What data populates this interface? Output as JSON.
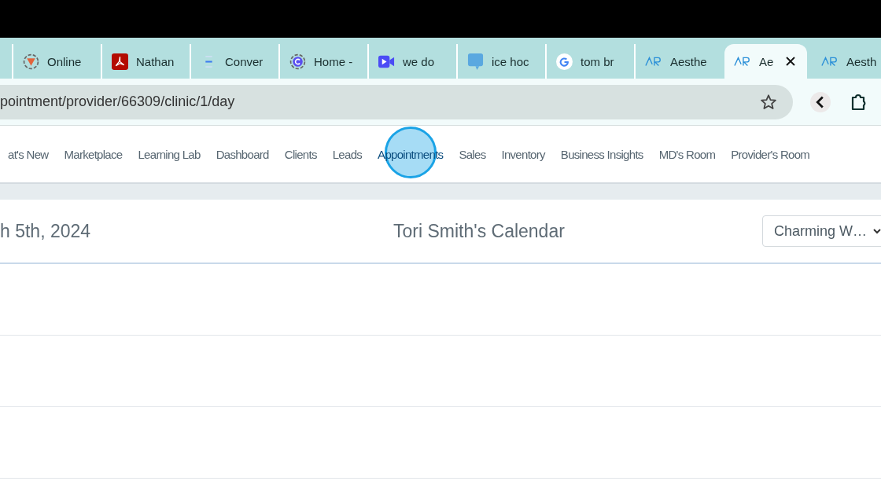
{
  "browser_tabs": [
    {
      "title": "Online",
      "kind": "shield",
      "selected": false
    },
    {
      "title": "Nathan",
      "kind": "pdf",
      "selected": false
    },
    {
      "title": "Conver",
      "kind": "bars",
      "selected": false
    },
    {
      "title": "Home -",
      "kind": "circle",
      "selected": false
    },
    {
      "title": "we do",
      "kind": "video",
      "selected": false
    },
    {
      "title": "ice hoc",
      "kind": "chat",
      "selected": false
    },
    {
      "title": "tom br",
      "kind": "google",
      "selected": false
    },
    {
      "title": "Aesthe",
      "kind": "ar",
      "selected": false
    },
    {
      "title": "Ae",
      "kind": "ar",
      "selected": true
    },
    {
      "title": "Aesth",
      "kind": "ar",
      "selected": false
    }
  ],
  "address_bar": {
    "url": "pointment/provider/66309/clinic/1/day"
  },
  "nav": [
    {
      "label": "at's New",
      "selected": false
    },
    {
      "label": "Marketplace",
      "selected": false
    },
    {
      "label": "Learning Lab",
      "selected": false
    },
    {
      "label": "Dashboard",
      "selected": false
    },
    {
      "label": "Clients",
      "selected": false
    },
    {
      "label": "Leads",
      "selected": false
    },
    {
      "label": "Appointments",
      "selected": true
    },
    {
      "label": "Sales",
      "selected": false
    },
    {
      "label": "Inventory",
      "selected": false
    },
    {
      "label": "Business Insights",
      "selected": false
    },
    {
      "label": "MD's Room",
      "selected": false
    },
    {
      "label": "Provider's Room",
      "selected": false
    }
  ],
  "pointer_highlight": true,
  "calendar": {
    "date": "h 5th, 2024",
    "title": "Tori Smith's Calendar",
    "location_select": "Charming W…"
  }
}
